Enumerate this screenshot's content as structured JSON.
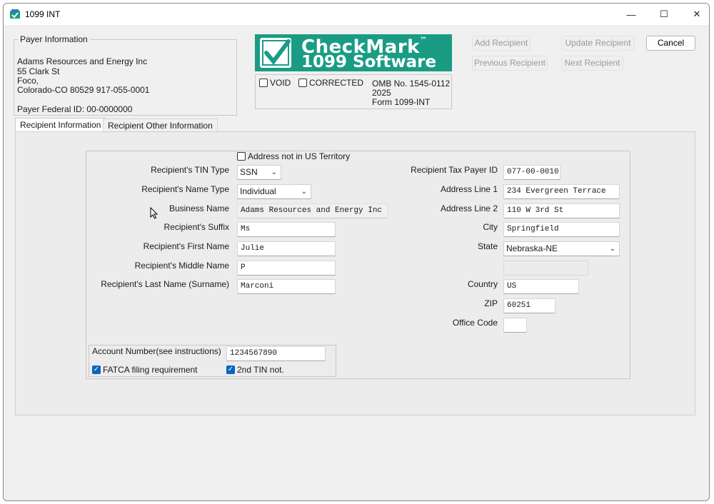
{
  "window": {
    "title": "1099 INT",
    "controls": {
      "minimize": "—",
      "maximize": "☐",
      "close": "✕"
    }
  },
  "payer": {
    "group_title": "Payer Information",
    "name": "Adams Resources and Energy Inc",
    "address": "55 Clark St",
    "city": "Foco,",
    "state_zip_phone": "Colorado-CO  80529  917-055-0001",
    "federal_id": "Payer Federal ID: 00-0000000"
  },
  "logo": {
    "line1": "CheckMark",
    "tm": "™",
    "line2": "1099 Software"
  },
  "form_info": {
    "void_label": "VOID",
    "corrected_label": "CORRECTED",
    "omb": "OMB No. 1545-0112",
    "year": "2025",
    "form": "Form 1099-INT"
  },
  "buttons": {
    "add_recipient": "Add Recipient",
    "update_recipient": "Update Recipient",
    "cancel": "Cancel",
    "previous_recipient": "Previous Recipient",
    "next_recipient": "Next Recipient"
  },
  "tabs": {
    "recipient_info": "Recipient Information",
    "recipient_other": "Recipient Other Information"
  },
  "recipient": {
    "address_not_us_label": "Address not in US Territory",
    "tin_type_label": "Recipient's TIN Type",
    "tin_type_value": "SSN",
    "name_type_label": "Recipient's Name Type",
    "name_type_value": "Individual",
    "business_name_label": "Business Name",
    "business_name_value": "Adams Resources and Energy Inc",
    "suffix_label": "Recipient's Suffix",
    "suffix_value": "Ms",
    "first_name_label": "Recipient's First Name",
    "first_name_value": "Julie",
    "middle_name_label": "Recipient's Middle Name",
    "middle_name_value": "P",
    "last_name_label": "Recipient's Last Name (Surname)",
    "last_name_value": "Marconi",
    "tax_payer_id_label": "Recipient Tax Payer ID",
    "tax_payer_id_value": "077-00-0010",
    "address1_label": "Address Line 1",
    "address1_value": "234 Evergreen Terrace",
    "address2_label": "Address Line 2",
    "address2_value": "110 W 3rd St",
    "city_label": "City",
    "city_value": "Springfield",
    "state_label": "State",
    "state_value": "Nebraska-NE",
    "country_label": "Country",
    "country_value": "US",
    "zip_label": "ZIP",
    "zip_value": "60251",
    "office_code_label": "Office Code",
    "office_code_value": ""
  },
  "account": {
    "label": "Account Number(see instructions)",
    "value": "1234567890",
    "fatca_label": "FATCA filing requirement",
    "fatca_checked": true,
    "second_tin_label": "2nd TIN not.",
    "second_tin_checked": true
  },
  "colors": {
    "logo_bg": "#1a9c84",
    "checkbox_checked": "#0a64c0"
  }
}
